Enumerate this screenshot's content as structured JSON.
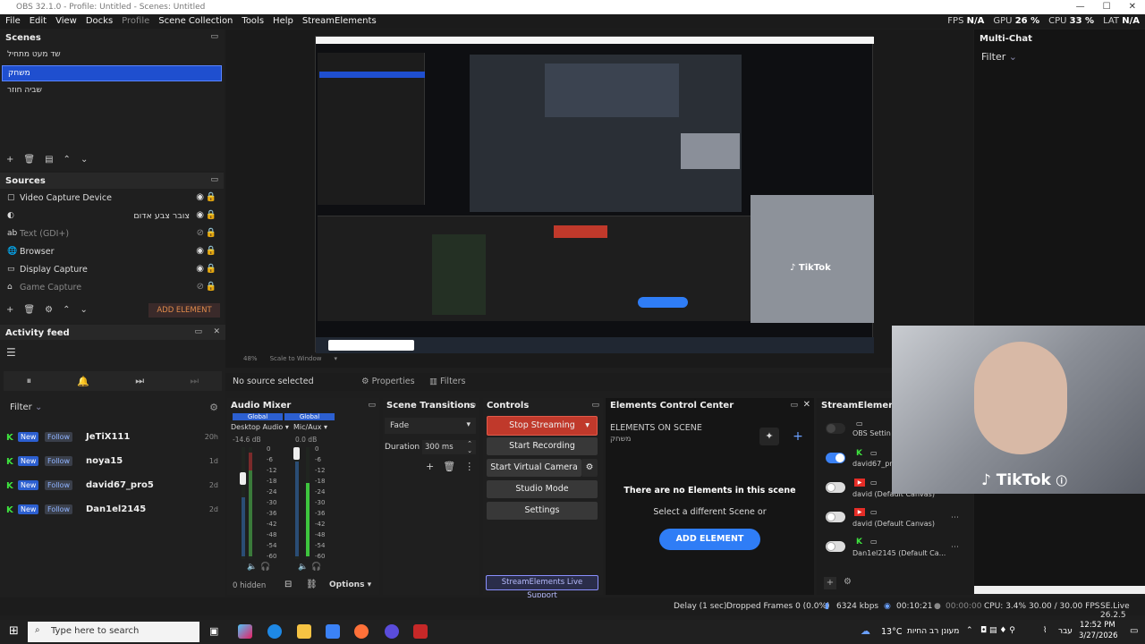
{
  "window": {
    "title": "OBS 32.1.0 - Profile: Untitled - Scenes: Untitled"
  },
  "menu": {
    "items": [
      "File",
      "Edit",
      "View",
      "Docks",
      "Profile",
      "Scene Collection",
      "Tools",
      "Help",
      "StreamElements"
    ]
  },
  "stats": {
    "fps_label": "FPS",
    "fps": "N/A",
    "gpu_label": "GPU",
    "gpu": "26 %",
    "cpu_label": "CPU",
    "cpu": "33 %",
    "lat_label": "LAT",
    "lat": "N/A"
  },
  "scenes": {
    "title": "Scenes",
    "items": [
      "שד מעט מתחיל",
      "משחק",
      "שביה חוזר"
    ],
    "selected": 1
  },
  "sources": {
    "title": "Sources",
    "items": [
      {
        "name": "Video Capture Device",
        "icon": "camera-icon",
        "dim": false
      },
      {
        "name": "צובר צבע אדום",
        "icon": "color-icon",
        "dim": false
      },
      {
        "name": "Text (GDI+)",
        "icon": "text-icon",
        "dim": true
      },
      {
        "name": "Browser",
        "icon": "globe-icon",
        "dim": false
      },
      {
        "name": "Display Capture",
        "icon": "monitor-icon",
        "dim": false
      },
      {
        "name": "Game Capture",
        "icon": "gamepad-icon",
        "dim": true
      }
    ],
    "add_element": "ADD ELEMENT"
  },
  "activity": {
    "title": "Activity feed",
    "filter": "Filter",
    "rows": [
      {
        "chip1": "New",
        "chip2": "Follow",
        "user": "JeTiX111",
        "time": "20h"
      },
      {
        "chip1": "New",
        "chip2": "Follow",
        "user": "noya15",
        "time": "1d"
      },
      {
        "chip1": "New",
        "chip2": "Follow",
        "user": "david67_pro5",
        "time": "2d"
      },
      {
        "chip1": "New",
        "chip2": "Follow",
        "user": "Dan1el2145",
        "time": "2d"
      }
    ]
  },
  "preview": {
    "scale_text": "Scale to Window",
    "zoom": "48%",
    "tiktok": "TikTok"
  },
  "multichat": {
    "title": "Multi-Chat",
    "filter": "Filter"
  },
  "selection_bar": {
    "no_source": "No source selected",
    "properties": "Properties",
    "filters": "Filters"
  },
  "audio": {
    "title": "Audio Mixer",
    "ch1": {
      "name": "Desktop Audio",
      "badge": "Global",
      "db": "-14.6 dB"
    },
    "ch2": {
      "name": "Mic/Aux",
      "badge": "Global",
      "db": "0.0 dB"
    },
    "ticks": [
      "0",
      "-6",
      "-12",
      "-18",
      "-24",
      "-30",
      "-36",
      "-42",
      "-48",
      "-54",
      "-60"
    ],
    "hidden": "0 hidden",
    "options": "Options",
    "ch1_level": 0.75,
    "ch2_level": 1.0
  },
  "transitions": {
    "title": "Scene Transitions",
    "value": "Fade",
    "duration_label": "Duration",
    "duration": "300 ms"
  },
  "controls": {
    "title": "Controls",
    "stop": "Stop Streaming",
    "rec": "Start Recording",
    "vcam": "Start Virtual Camera",
    "studio": "Studio Mode",
    "settings": "Settings",
    "support": "StreamElements Live Support"
  },
  "ecc": {
    "title": "Elements Control Center",
    "on_scene": "ELEMENTS ON SCENE",
    "scene_name": "משחק",
    "empty": "There are no Elements in this scene",
    "hint": "Select a different Scene or",
    "add": "ADD ELEMENT"
  },
  "se_panel": {
    "title": "StreamElements M",
    "rows": [
      {
        "label": "OBS Settin",
        "on": false
      },
      {
        "label": "david67_pr",
        "on": true
      },
      {
        "label": "david (Default Canvas)",
        "on": false
      },
      {
        "label": "david (Default Canvas)",
        "on": false
      },
      {
        "label": "Dan1el2145 (Default Ca...",
        "on": false
      }
    ]
  },
  "status": {
    "delay": "Delay (1 sec)",
    "dropped": "Dropped Frames 0 (0.0%)",
    "kbps": "6324 kbps",
    "live_time": "00:10:21",
    "rec_time": "00:00:00",
    "cpu": "CPU: 3.4%",
    "fps": "30.00 / 30.00 FPS",
    "se": "SE.Live 26.2.5"
  },
  "taskbar": {
    "search": "Type here to search",
    "weather": "13°C",
    "weather_hebrew": "מעונן רב החיות",
    "lang": "עבר",
    "time": "12:52 PM",
    "date": "3/27/2026"
  },
  "colors": {
    "accent": "#1f4fcf",
    "stop_red": "#c0392b",
    "add_blue": "#2f7df6",
    "kick_green": "#3ee33e"
  }
}
